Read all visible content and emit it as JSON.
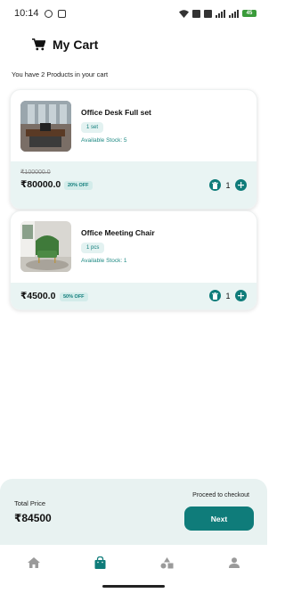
{
  "status_bar": {
    "time": "10:14",
    "battery": "45"
  },
  "header": {
    "title": "My Cart"
  },
  "cart_summary_text": "You have 2 Products in your cart",
  "items": [
    {
      "name": "Office Desk Full set",
      "quantity_unit": "1 set",
      "stock": "Available Stock: 5",
      "old_price": "₹100000.0",
      "price": "₹80000.0",
      "discount": "20% OFF",
      "qty": "1"
    },
    {
      "name": "Office Meeting Chair",
      "quantity_unit": "1 pcs",
      "stock": "Available Stock: 1",
      "old_price": "",
      "price": "₹4500.0",
      "discount": "50% OFF",
      "qty": "1"
    }
  ],
  "footer": {
    "total_label": "Total Price",
    "total_value": "₹84500",
    "proceed_text": "Proceed to checkout",
    "next_label": "Next"
  },
  "colors": {
    "accent": "#0f7c7a",
    "summary_bg": "#e8f2f1",
    "chip_bg": "#e3f2f1"
  },
  "nav": {
    "items": [
      "home-icon",
      "shopping-bag-icon",
      "categories-icon",
      "profile-icon"
    ],
    "active": "shopping-bag-icon"
  }
}
